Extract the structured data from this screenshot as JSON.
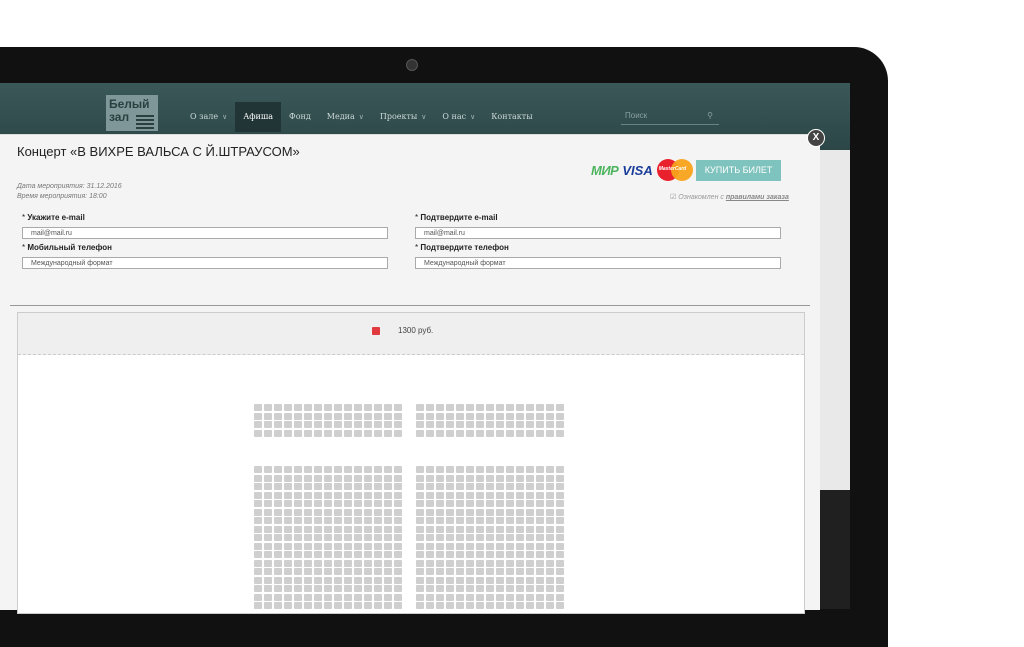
{
  "header": {
    "logo_line1": "Белый",
    "logo_line2": "зал",
    "nav": [
      {
        "label": "О зале",
        "has_dropdown": true
      },
      {
        "label": "Афиша",
        "has_dropdown": false,
        "active": true
      },
      {
        "label": "Фонд",
        "has_dropdown": false
      },
      {
        "label": "Медиа",
        "has_dropdown": true
      },
      {
        "label": "Проекты",
        "has_dropdown": true
      },
      {
        "label": "О нас",
        "has_dropdown": true
      },
      {
        "label": "Контакты",
        "has_dropdown": false
      }
    ],
    "search_placeholder": "Поиск"
  },
  "modal": {
    "close_label": "X",
    "title": "Концерт «В ВИХРЕ ВАЛЬСА С Й.ШТРАУСОМ»",
    "event_date": "Дата мероприятия: 31.12.2016",
    "event_time": "Время мероприятия: 18:00",
    "payment": {
      "mir": "МИР",
      "visa": "VISA",
      "mastercard": "MasterCard",
      "buy_label": "КУПИТЬ БИЛЕТ"
    },
    "agreement_prefix": "Ознакомлен с ",
    "agreement_link": "правилами заказа",
    "agreement_checked": true,
    "fields": {
      "email_label": "Укажите e-mail",
      "email_value": "mail@mail.ru",
      "confirm_email_label": "Подтвердите e-mail",
      "confirm_email_value": "mail@mail.ru",
      "phone_label": "Мобильный телефон",
      "phone_placeholder": "Международный формат",
      "confirm_phone_label": "Подтвердите телефон",
      "confirm_phone_placeholder": "Международный формат",
      "required_mark": "*"
    },
    "legend": {
      "price": "1300 руб.",
      "color": "#e0393e"
    }
  },
  "colors": {
    "accent": "#7fc3be",
    "header_bg": "#2f4a4c",
    "seat_available": "#cfcfcf"
  }
}
